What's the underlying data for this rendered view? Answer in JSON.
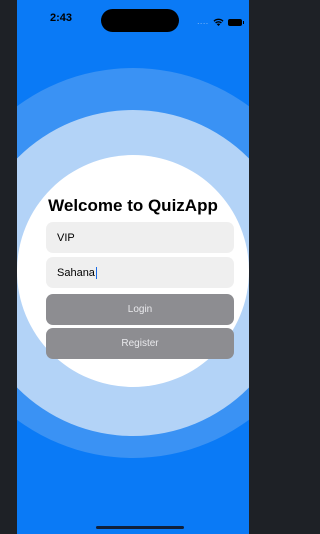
{
  "status_bar": {
    "time": "2:43",
    "signal": "....",
    "wifi_icon": "wifi-icon",
    "battery_icon": "battery-icon"
  },
  "screen": {
    "title": "Welcome to QuizApp",
    "username_value": "VIP",
    "password_value": "Sahana",
    "login_label": "Login",
    "register_label": "Register"
  },
  "colors": {
    "background": "#0a7af6",
    "ring_outer": "#3a92f4",
    "ring_middle": "#b3d3f7",
    "button": "#8d8d91"
  }
}
